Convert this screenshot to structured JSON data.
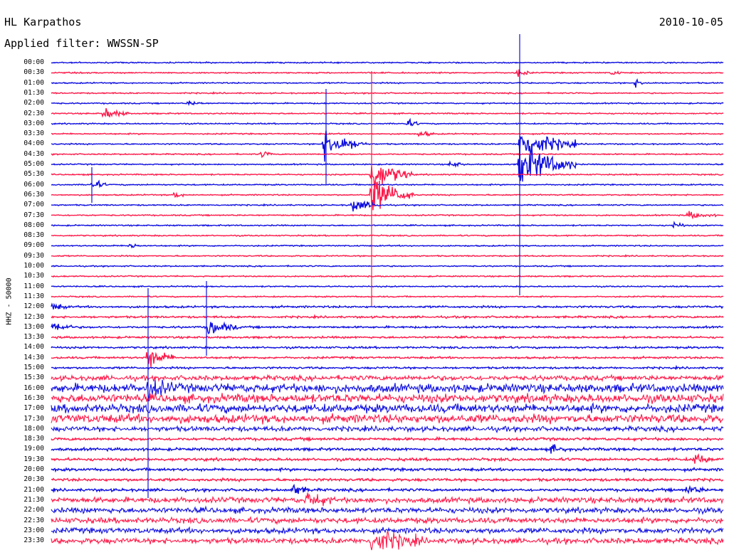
{
  "header": {
    "station": "HL Karpathos",
    "date": "2010-10-05",
    "filter": "Applied filter: WWSSN-SP",
    "channel": "HHZ - 50000"
  },
  "colors": {
    "trace_a": "#1010e0",
    "trace_b": "#ff1a4a"
  },
  "time_labels": [
    "00:00",
    "00:30",
    "01:00",
    "01:30",
    "02:00",
    "02:30",
    "03:00",
    "03:30",
    "04:00",
    "04:30",
    "05:00",
    "05:30",
    "06:00",
    "06:30",
    "07:00",
    "07:30",
    "08:00",
    "08:30",
    "09:00",
    "09:30",
    "10:00",
    "10:30",
    "11:00",
    "11:30",
    "12:00",
    "12:30",
    "13:00",
    "13:30",
    "14:00",
    "14:30",
    "15:00",
    "15:30",
    "16:00",
    "16:30",
    "17:00",
    "17:30",
    "18:00",
    "18:30",
    "19:00",
    "19:30",
    "20:00",
    "20:30",
    "21:00",
    "21:30",
    "22:00",
    "22:30",
    "23:00",
    "23:30"
  ]
}
